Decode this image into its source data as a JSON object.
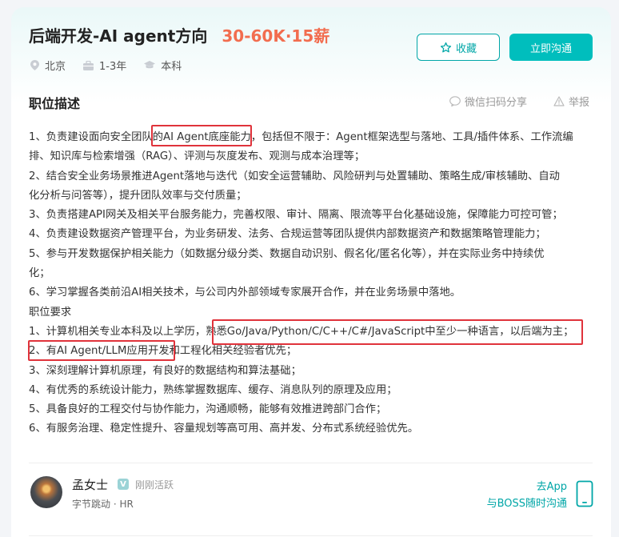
{
  "header": {
    "title": "后端开发-AI agent方向",
    "salary": "30-60K·15薪",
    "location": "北京",
    "experience": "1-3年",
    "education": "本科",
    "fav_label": "收藏",
    "chat_label": "立即沟通"
  },
  "section": {
    "title": "职位描述",
    "share_label": "微信扫码分享",
    "report_label": "举报"
  },
  "description": [
    "1、负责建设面向安全团队的AI Agent底座能力，包括但不限于：Agent框架选型与落地、工具/插件体系、工作流编",
    "排、知识库与检索增强（RAG）、评测与灰度发布、观测与成本治理等；",
    "2、结合安全业务场景推进Agent落地与迭代（如安全运营辅助、风险研判与处置辅助、策略生成/审核辅助、自动",
    "化分析与问答等），提升团队效率与交付质量；",
    "3、负责搭建API网关及相关平台服务能力，完善权限、审计、隔离、限流等平台化基础设施，保障能力可控可管；",
    "4、负责建设数据资产管理平台，为业务研发、法务、合规运营等团队提供内部数据资产和数据策略管理能力；",
    "5、参与开发数据保护相关能力（如数据分级分类、数据自动识别、假名化/匿名化等），并在实际业务中持续优",
    "化；",
    "6、学习掌握各类前沿AI相关技术，与公司内外部领域专家展开合作，并在业务场景中落地。",
    "职位要求",
    "1、计算机相关专业本科及以上学历，熟悉Go/Java/Python/C/C++/C#/JavaScript中至少一种语言，以后端为主；",
    "2、有AI Agent/LLM应用开发和工程化相关经验者优先；",
    "3、深刻理解计算机原理，有良好的数据结构和算法基础；",
    "4、有优秀的系统设计能力，熟练掌握数据库、缓存、消息队列的原理及应用；",
    "5、具备良好的工程交付与协作能力，沟通顺畅，能够有效推进跨部门合作；",
    "6、有服务治理、稳定性提升、容量规划等高可用、高并发、分布式系统经验优先。"
  ],
  "recruiter": {
    "name": "孟女士",
    "verified_mark": "V",
    "status": "刚刚活跃",
    "company": "字节跳动 · HR"
  },
  "app_link": {
    "line1": "去App",
    "line2": "与BOSS随时沟通"
  },
  "colors": {
    "accent": "#00bebd",
    "salary": "#f26d4f",
    "highlight_box": "#e0333b"
  },
  "icons": [
    "location-icon",
    "briefcase-icon",
    "graduation-cap-icon",
    "star-icon",
    "wechat-icon",
    "warning-icon",
    "phone-icon"
  ]
}
